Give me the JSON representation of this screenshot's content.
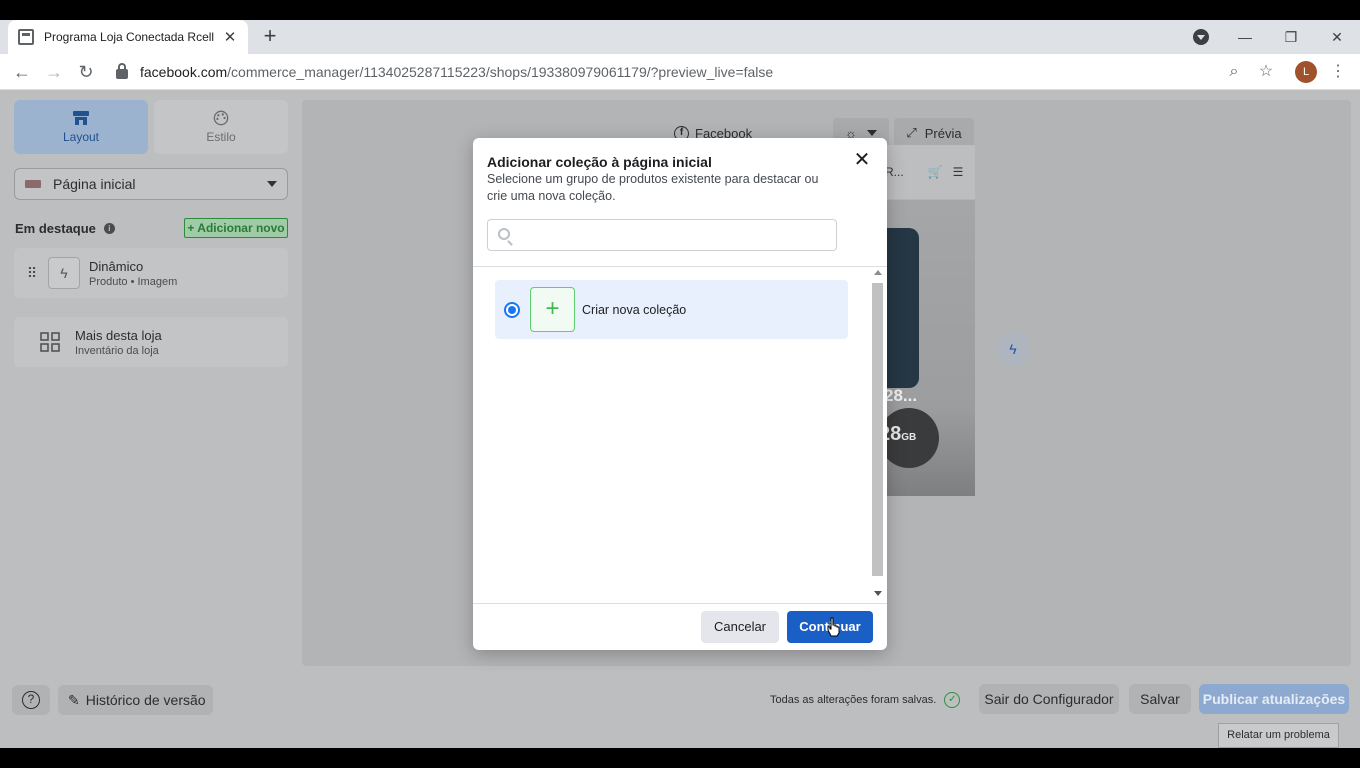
{
  "browser": {
    "tab_title": "Programa Loja Conectada Rcell",
    "url_host": "facebook.com",
    "url_path": "/commerce_manager/1134025287115223/shops/193380979061179/?preview_live=false",
    "profile_initial": "L"
  },
  "sidebar": {
    "tabs": [
      {
        "label": "Layout"
      },
      {
        "label": "Estilo"
      }
    ],
    "page_select": "Página inicial",
    "section_title": "Em destaque",
    "add_new": "+ Adicionar novo",
    "cards": [
      {
        "title": "Dinâmico",
        "subtitle": "Produto • Imagem"
      },
      {
        "title": "Mais desta loja",
        "subtitle": "Inventário da loja"
      }
    ]
  },
  "preview": {
    "facebook_label": "Facebook",
    "preview_label": "Prévia",
    "phone_header_text": "R...",
    "phone_price_text": "28...",
    "phone_storage": "28",
    "phone_storage_unit": "GB"
  },
  "modal": {
    "title": "Adicionar coleção à página inicial",
    "subtitle": "Selecione um grupo de produtos existente para destacar ou crie uma nova coleção.",
    "search_placeholder": "",
    "option_label": "Criar nova coleção",
    "cancel_label": "Cancelar",
    "continue_label": "Continuar"
  },
  "footer": {
    "history_label": "Histórico de versão",
    "saved_message": "Todas as alterações foram salvas.",
    "exit_label": "Sair do Configurador",
    "save_label": "Salvar",
    "publish_label": "Publicar atualizações",
    "report_label": "Relatar um problema"
  },
  "colors": {
    "accent": "#1a5fc6",
    "selected_option_bg": "#e7f0fc",
    "add_new_green": "#2a7a36"
  }
}
